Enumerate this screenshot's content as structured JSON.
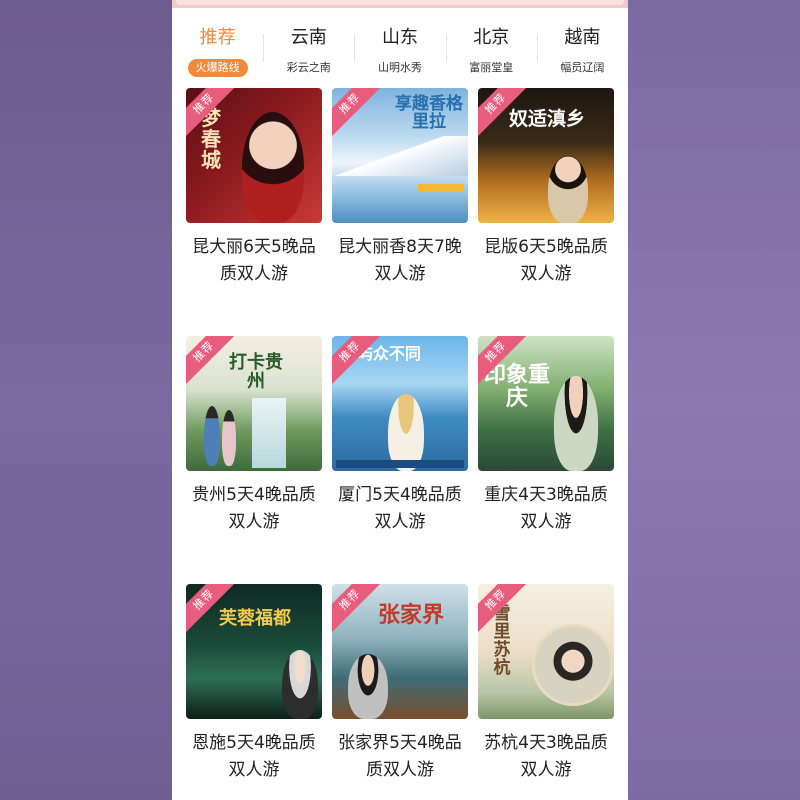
{
  "tabs": [
    {
      "title": "推荐",
      "sub": "火爆路线",
      "active": true
    },
    {
      "title": "云南",
      "sub": "彩云之南",
      "active": false
    },
    {
      "title": "山东",
      "sub": "山明水秀",
      "active": false
    },
    {
      "title": "北京",
      "sub": "富丽堂皇",
      "active": false
    },
    {
      "title": "越南",
      "sub": "幅员辽阔",
      "active": false
    }
  ],
  "badge_label": "推荐",
  "products": [
    {
      "title": "昆大丽6天5晚品质双人游",
      "poster_text": "梦春城"
    },
    {
      "title": "昆大丽香8天7晚双人游",
      "poster_text": "享趣香格里拉"
    },
    {
      "title": "昆版6天5晚品质双人游",
      "poster_text": "奴适滇乡"
    },
    {
      "title": "贵州5天4晚品质双人游",
      "poster_text": "打卡贵州"
    },
    {
      "title": "厦门5天4晚品质双人游",
      "poster_text": "屿众不同"
    },
    {
      "title": "重庆4天3晚品质双人游",
      "poster_text": "印象重庆"
    },
    {
      "title": "恩施5天4晚品质双人游",
      "poster_text": "芙蓉福都"
    },
    {
      "title": "张家界5天4晚品质双人游",
      "poster_text": "张家界"
    },
    {
      "title": "苏杭4天3晚品质双人游",
      "poster_text": "雪里苏杭"
    }
  ],
  "colors": {
    "accent": "#f08a3c",
    "badge": "#e85d7e"
  }
}
